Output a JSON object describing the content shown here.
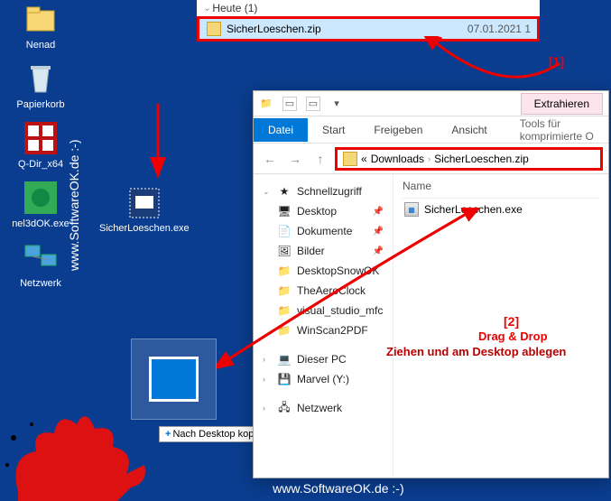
{
  "desktop": {
    "icons": [
      {
        "label": "Nenad"
      },
      {
        "label": "Papierkorb"
      },
      {
        "label": "Q-Dir_x64"
      },
      {
        "label": "nel3dOK.exe"
      },
      {
        "label": "Netzwerk"
      }
    ]
  },
  "drag_target": {
    "label": "SicherLoeschen.exe"
  },
  "tooltip": {
    "plus": "+",
    "text": "Nach Desktop kopieren"
  },
  "top_group": {
    "header": "Heute (1)",
    "filename": "SicherLoeschen.zip",
    "date": "07.01.2021 1"
  },
  "explorer": {
    "extract": "Extrahieren",
    "tabs": {
      "datei": "Datei",
      "start": "Start",
      "freigeben": "Freigeben",
      "ansicht": "Ansicht",
      "tools": "Tools für komprimierte O"
    },
    "address": {
      "prefix": "«",
      "seg1": "Downloads",
      "seg2": "SicherLoeschen.zip"
    },
    "sidebar": {
      "quick": "Schnellzugriff",
      "items": [
        "Desktop",
        "Dokumente",
        "Bilder",
        "DesktopSnowOK",
        "TheAeroClock",
        "visual_studio_mfc",
        "WinScan2PDF"
      ],
      "thispc": "Dieser PC",
      "marvel": "Marvel (Y:)",
      "network": "Netzwerk"
    },
    "filepane": {
      "col_name": "Name",
      "file": "SicherLoeschen.exe"
    }
  },
  "annotations": {
    "one": "[1]",
    "two": "[2]",
    "dragdrop_en": "Drag & Drop",
    "dragdrop_de": "Ziehen und am Desktop ablegen"
  },
  "watermark": "www.SoftwareOK.de :-)"
}
